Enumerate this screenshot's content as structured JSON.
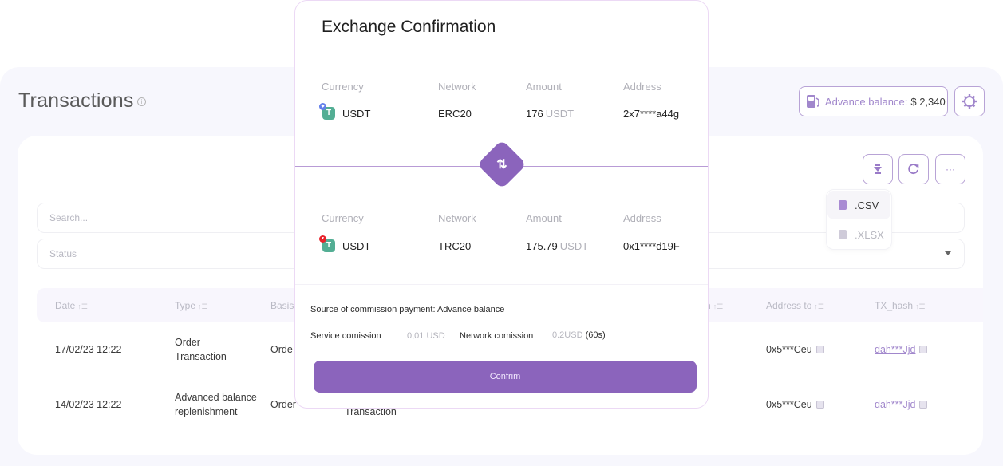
{
  "page": {
    "title": "Transactions",
    "info_icon": "info-circle-icon",
    "advance_balance_label": "Advance balance:",
    "advance_balance_value": "$ 2,340",
    "fuel_icon": "fuel-pump-icon",
    "settings_icon": "gear-icon"
  },
  "toolbar": {
    "download_icon": "download-icon",
    "refresh_icon": "refresh-icon",
    "more_label": "···"
  },
  "export_menu": {
    "items": [
      {
        "label": ".CSV",
        "icon": "csv-file-icon",
        "state": "active"
      },
      {
        "label": ".XLSX",
        "icon": "xlsx-file-icon",
        "state": "disabled"
      }
    ]
  },
  "filters": {
    "search_placeholder": "Search...",
    "status_placeholder": "Status",
    "right_search_placeholder": "...",
    "right_status_placeholder": "..."
  },
  "table": {
    "columns": [
      "Date",
      "Type",
      "Basis",
      "n",
      "Address to",
      "TX_hash"
    ],
    "rows": [
      {
        "date": "17/02/23 12:22",
        "type_line1": "Order",
        "type_line2": "Transaction",
        "basis": "Orde",
        "address_to": "0x5***Ceu",
        "tx_hash": "dah***Jjd"
      },
      {
        "date": "14/02/23 12:22",
        "type_line1": "Advanced balance",
        "type_line2": "replenishment",
        "basis": "Order",
        "extra": "Transaction",
        "address_to": "0x5***Ceu",
        "tx_hash": "dah***Jjd"
      }
    ]
  },
  "modal": {
    "title": "Exchange Confirmation",
    "from": {
      "labels": {
        "currency": "Currency",
        "network": "Network",
        "amount": "Amount",
        "address": "Address"
      },
      "currency": "USDT",
      "network": "ERC20",
      "amount": "176",
      "amount_unit": "USDT",
      "address": "2x7****a44g",
      "badge_color": "#627eea"
    },
    "to": {
      "labels": {
        "currency": "Currency",
        "network": "Network",
        "amount": "Amount",
        "address": "Address"
      },
      "currency": "USDT",
      "network": "TRC20",
      "amount": "175.79",
      "amount_unit": "USDT",
      "address": "0x1****d19F",
      "badge_color": "#e8222b"
    },
    "swap_icon": "swap-arrows-icon",
    "commission_source": "Source of commission payment: Advance balance",
    "service_commission_label": "Service comission",
    "service_commission_value": "0,01 USD",
    "network_commission_label": "Network comission",
    "network_commission_value": "0.2USD",
    "network_commission_timer": "(60s)",
    "confirm_label": "Confrim"
  },
  "colors": {
    "accent": "#8b64bc",
    "accent_light": "#a187cc",
    "tether": "#53ae94"
  }
}
